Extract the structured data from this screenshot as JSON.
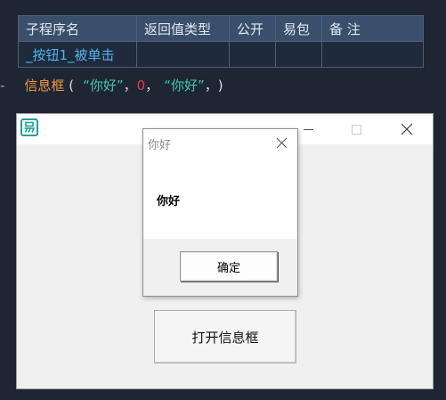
{
  "sub_table": {
    "headers": {
      "name": "子程序名",
      "return_type": "返回值类型",
      "public": "公开",
      "package": "易包",
      "note": "备 注"
    },
    "row": {
      "name": "_按钮1_被单击",
      "return_type": "",
      "public": "",
      "package": "",
      "note": ""
    }
  },
  "code": {
    "dash": "-",
    "function": "信息框",
    "open_paren": " (",
    "arg1": "“你好”",
    "comma1": "，",
    "arg2": "0",
    "comma2": "，",
    "arg3": "“你好”",
    "comma3": "，",
    "close_paren": ")"
  },
  "app_window": {
    "icon": "easy-language-icon",
    "button_label": "打开信息框"
  },
  "message_box": {
    "title": "你好",
    "text": "你好",
    "ok_label": "确定"
  },
  "colors": {
    "background": "#1e2634",
    "table_header": "#3a4f6b",
    "function_name": "#f29a3e",
    "string": "#3fc9b0",
    "number": "#e23b4c",
    "sub_name": "#4fb4f2",
    "icon_accent": "#1ba29a"
  }
}
